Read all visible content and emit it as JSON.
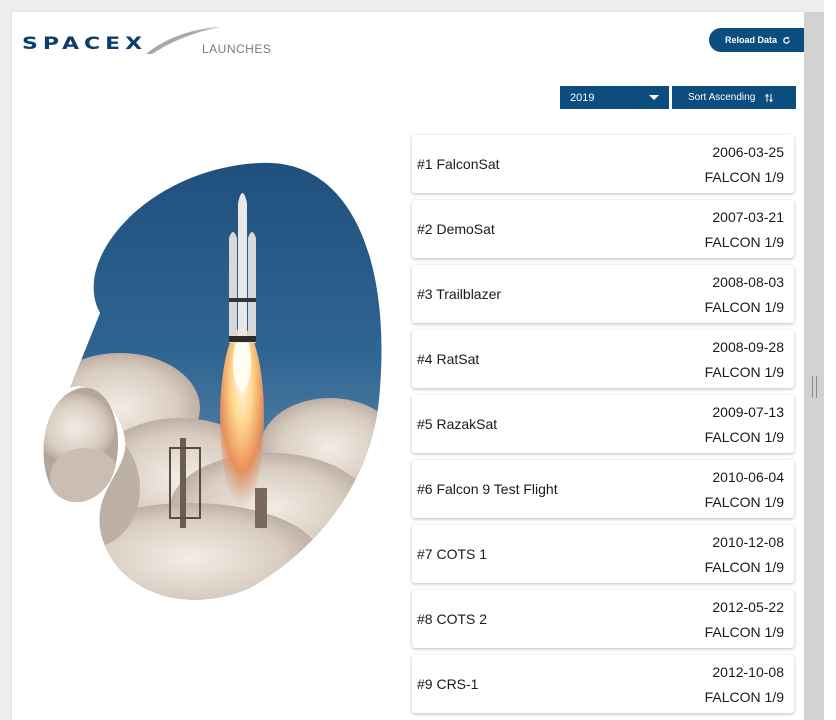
{
  "header": {
    "logo_text": "SPACEX",
    "logo_subtitle": "LAUNCHES",
    "reload_label": "Reload Data",
    "reload_icon": "refresh-icon"
  },
  "controls": {
    "year_filter": {
      "selected": "2019",
      "icon": "chevron-down-icon"
    },
    "sort_label": "Sort Ascending",
    "sort_icon": "sort-arrows-icon"
  },
  "colors": {
    "primary": "#0b4d7e",
    "logo": "#0b3f6b",
    "background": "#ffffff"
  },
  "launches": [
    {
      "name": "#1 FalconSat",
      "date": "2006-03-25",
      "rocket": "FALCON 1/9"
    },
    {
      "name": "#2 DemoSat",
      "date": "2007-03-21",
      "rocket": "FALCON 1/9"
    },
    {
      "name": "#3 Trailblazer",
      "date": "2008-08-03",
      "rocket": "FALCON 1/9"
    },
    {
      "name": "#4 RatSat",
      "date": "2008-09-28",
      "rocket": "FALCON 1/9"
    },
    {
      "name": "#5 RazakSat",
      "date": "2009-07-13",
      "rocket": "FALCON 1/9"
    },
    {
      "name": "#6 Falcon 9 Test Flight",
      "date": "2010-06-04",
      "rocket": "FALCON 1/9"
    },
    {
      "name": "#7 COTS 1",
      "date": "2010-12-08",
      "rocket": "FALCON 1/9"
    },
    {
      "name": "#8 COTS 2",
      "date": "2012-05-22",
      "rocket": "FALCON 1/9"
    },
    {
      "name": "#9 CRS-1",
      "date": "2012-10-08",
      "rocket": "FALCON 1/9"
    }
  ]
}
